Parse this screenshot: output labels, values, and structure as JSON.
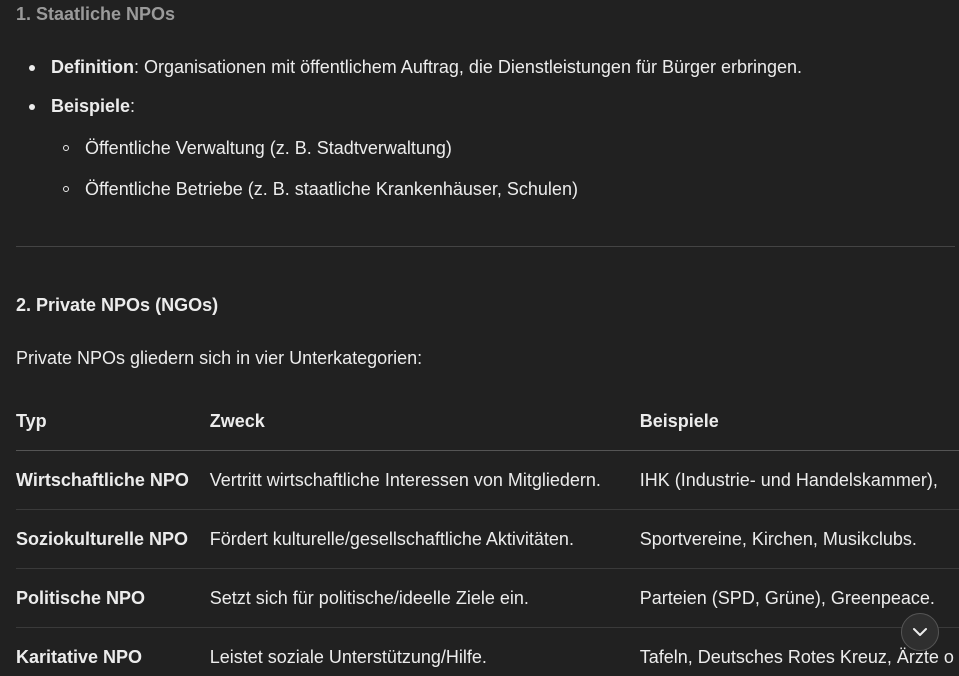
{
  "section1": {
    "title": "1. Staatliche NPOs",
    "definition_label": "Definition",
    "definition_text": ": Organisationen mit öffentlichem Auftrag, die Dienstleistungen für Bürger erbringen.",
    "examples_label": "Beispiele",
    "examples_colon": ":",
    "examples": [
      "Öffentliche Verwaltung (z. B. Stadtverwaltung)",
      "Öffentliche Betriebe (z. B. staatliche Krankenhäuser, Schulen)"
    ]
  },
  "section2": {
    "title": "2. Private NPOs (NGOs)",
    "intro": "Private NPOs gliedern sich in vier Unterkategorien:"
  },
  "table": {
    "headers": [
      "Typ",
      "Zweck",
      "Beispiele"
    ],
    "rows": [
      [
        "Wirtschaftliche NPO",
        "Vertritt wirtschaftliche Interessen von Mitgliedern.",
        "IHK (Industrie- und Handelskammer),"
      ],
      [
        "Soziokulturelle NPO",
        "Fördert kulturelle/gesellschaftliche Aktivitäten.",
        "Sportvereine, Kirchen, Musikclubs."
      ],
      [
        "Politische NPO",
        "Setzt sich für politische/ideelle Ziele ein.",
        "Parteien (SPD, Grüne), Greenpeace."
      ],
      [
        "Karitative NPO",
        "Leistet soziale Unterstützung/Hilfe.",
        "Tafeln, Deutsches Rotes Kreuz, Ärzte o"
      ]
    ]
  },
  "scroll_button": {
    "icon": "chevron-down-icon"
  }
}
